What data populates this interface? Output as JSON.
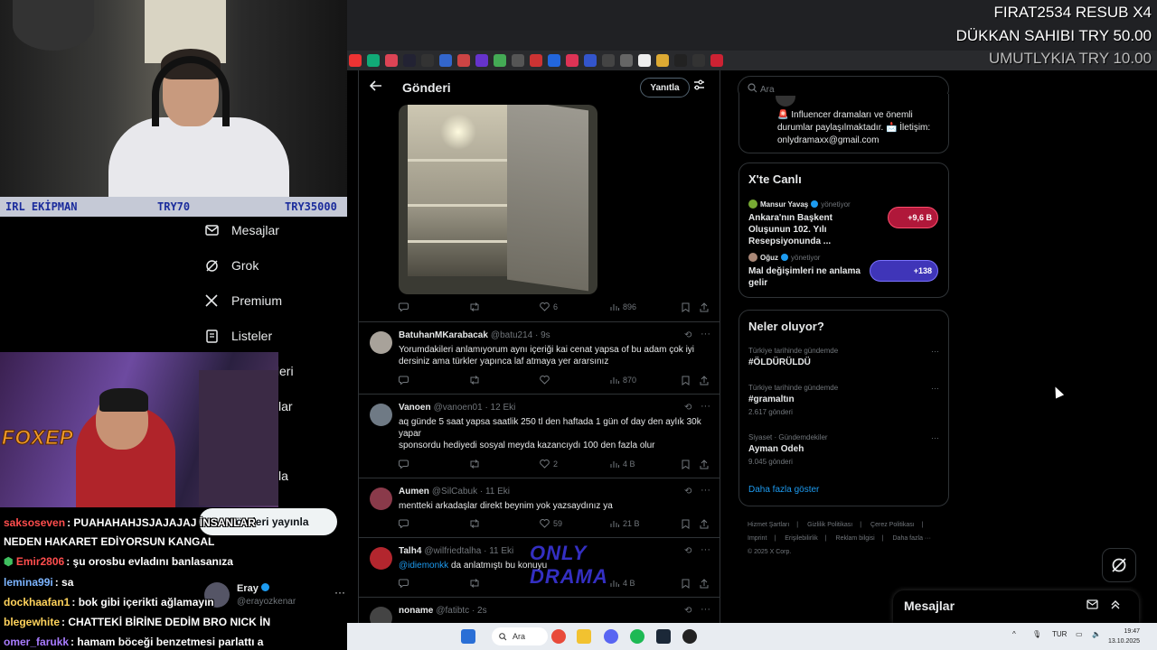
{
  "stream_overlay": {
    "irl_bar": {
      "label": "IRL EKİPMAN",
      "middle": "TRY70",
      "right": "TRY35000"
    },
    "cam2_brand": "FOXEP",
    "donations": [
      {
        "text": "FIRAT2534  RESUB X4",
        "color": "#ffffff"
      },
      {
        "text": "DÜKKAN SAHIBI  TRY 50.00",
        "color": "#ffffff"
      },
      {
        "text": "UMUTLYKIA  TRY 10.00",
        "color": "#bcbcbc"
      }
    ],
    "chat": [
      {
        "user": "saksoseven",
        "msg": ": PUAHAHAHJSJAJAJAJ İNSANLAR",
        "color": "#ff4d4d"
      },
      {
        "user": "",
        "msg": "NEDEN HAKARET EDİYORSUN KANGAL",
        "color": "#ffffff"
      },
      {
        "user": "Emir2806",
        "msg": ": şu orosbu evladını banlasanıza",
        "color": "#ff4d4d"
      },
      {
        "user": "lemina99i",
        "msg": ": sa",
        "color": "#7cb4ff"
      },
      {
        "user": "dockhaafan1",
        "msg": ": bok gibi içerikti ağlamayın",
        "color": "#ffd35c"
      },
      {
        "user": "blegewhite",
        "msg": ": CHATTEKİ BİRİNE DEDİM BRO NICK İN",
        "color": "#ffd35c"
      },
      {
        "user": "omer_farukk",
        "msg": ": hamam böceği benzetmesi parlattı a",
        "color": "#a97cff"
      }
    ],
    "watermark": [
      "ONLY",
      "DRAMA"
    ]
  },
  "x_nav": {
    "items": [
      {
        "label": "Mesajlar",
        "icon": "envelope-icon"
      },
      {
        "label": "Grok",
        "icon": "grok-icon"
      },
      {
        "label": "Premium",
        "icon": "x-logo-icon"
      },
      {
        "label": "Listeler",
        "icon": "list-icon"
      },
      {
        "label": "tleri",
        "icon": ""
      },
      {
        "label": "lar",
        "icon": ""
      },
      {
        "label": "la",
        "icon": ""
      }
    ],
    "post_button": "Gönderi yayınla",
    "account": {
      "name": "Eray",
      "handle": "@erayozkenar",
      "more": "···"
    }
  },
  "header": {
    "title": "Gönderi",
    "reply_button": "Yanıtla"
  },
  "main_post_actions": {
    "likes": "6",
    "views": "896"
  },
  "replies": [
    {
      "name": "BatuhanMKarabacak",
      "handle": "@batu214 · 9s",
      "text": "Yorumdakileri anlamıyorum aynı içeriği kai cenat yapsa of bu adam çok iyi dersiniz ama türkler yapınca laf atmaya yer ararsınız",
      "replies": "",
      "retweets": "",
      "likes": "",
      "views": "870",
      "avatar_color": "#a8a29a"
    },
    {
      "name": "Vanoen",
      "handle": "@vanoen01 · 12 Eki",
      "text": "aq günde 5 saat yapsa saatlik 250 tl den haftada 1 gün of day den aylık 30k yapar\nsponsordu hediyedi sosyal meyda kazancıydı  100 den fazla olur",
      "replies": "",
      "retweets": "",
      "likes": "2",
      "views": "4 B",
      "avatar_color": "#6f7a85"
    },
    {
      "name": "Aumen",
      "handle": "@SilCabuk · 11 Eki",
      "text": "mentteki arkadaşlar direkt beynim yok yazsaydınız ya",
      "replies": "",
      "retweets": "",
      "likes": "59",
      "views": "21 B",
      "avatar_color": "#8a3a4a"
    },
    {
      "name": "Talh4",
      "handle": "@wilfriedtalha · 11 Eki",
      "mention": "@idiemonkk",
      "text": " da anlatmıştı bu konuyu",
      "replies": "",
      "retweets": "",
      "likes": "",
      "views": "4 B",
      "avatar_color": "#b3262e"
    },
    {
      "name": "noname",
      "handle": "@fatibtc · 2s",
      "text": "",
      "avatar_color": "#444"
    }
  ],
  "sidebar": {
    "search_placeholder": "Ara",
    "bio": "🚨 Influencer dramaları ve önemli durumlar paylaşılmaktadır. 📩 İletişim: onlydramaxx@gmail.com",
    "live": {
      "title": "X'te Canlı",
      "items": [
        {
          "host": "Mansur Yavaş",
          "role": "yönetiyor",
          "topic": "Ankara'nın Başkent Oluşunun 102. Yılı Resepsiyonunda ...",
          "count": "+9,6 B",
          "pill_color": "#b0183a"
        },
        {
          "host": "Oğuz",
          "role": "yönetiyor",
          "topic": "Mal değişimleri ne anlama gelir",
          "count": "+138",
          "pill_color": "#3f35b8"
        }
      ]
    },
    "trends": {
      "title": "Neler oluyor?",
      "items": [
        {
          "context": "Türkiye tarihinde gündemde",
          "tag": "#ÖLDÜRÜLDÜ",
          "count": ""
        },
        {
          "context": "Türkiye tarihinde gündemde",
          "tag": "#gramaltın",
          "count": "2.617 gönderi"
        },
        {
          "context": "Siyaset · Gündemdekiler",
          "tag": "Ayman Odeh",
          "count": "9.045 gönderi"
        }
      ],
      "show_more": "Daha fazla göster"
    },
    "footer": [
      "Hizmet Şartları",
      "|",
      "Gizlilik Politikası",
      "|",
      "Çerez Politikası",
      "|",
      "Imprint",
      "|",
      "Erişilebilirlik",
      "|",
      "Reklam bilgisi",
      "|",
      "Daha fazla ···",
      "© 2025 X Corp."
    ],
    "messages_drawer": "Mesajlar"
  },
  "taskbar": {
    "search_label": "Ara",
    "language": "TUR",
    "time": "19:47",
    "date": "13.10.2025"
  }
}
